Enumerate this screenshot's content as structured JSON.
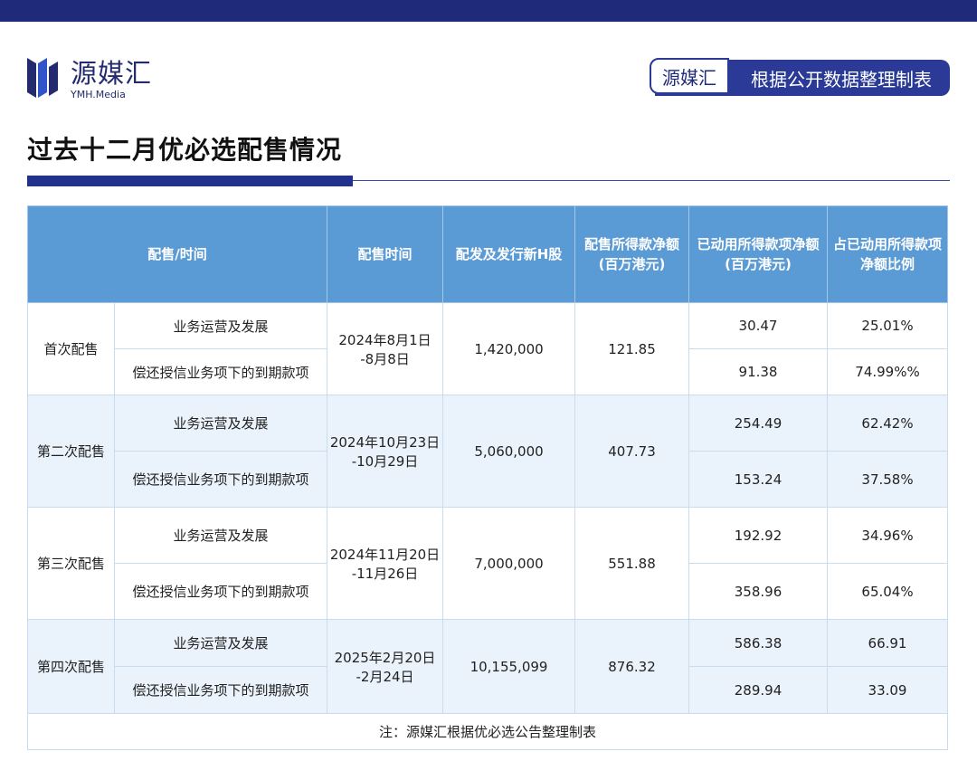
{
  "brand": {
    "name": "源媒汇",
    "sub": "YMH.Media"
  },
  "source_badge": {
    "left": "源媒汇",
    "right": "根据公开数据整理制表"
  },
  "title": "过去十二月优必选配售情况",
  "table": {
    "headers": {
      "col1": "配售/时间",
      "col2": "配售时间",
      "col3": "配发及发行新H股",
      "col4_l1": "配售所得款净额",
      "col4_l2": "(百万港元)",
      "col5_l1": "已动用所得款项净额",
      "col5_l2": "(百万港元)",
      "col6_l1": "占已动用所得款项",
      "col6_l2": "净额比例"
    },
    "groups": [
      {
        "name": "首次配售",
        "date_l1": "2024年8月1日",
        "date_l2": "-8月8日",
        "shares": "1,420,000",
        "net": "121.85",
        "rows": [
          {
            "use": "业务运营及发展",
            "used": "30.47",
            "pct": "25.01%"
          },
          {
            "use": "偿还授信业务项下的到期款项",
            "used": "91.38",
            "pct": "74.99%%"
          }
        ]
      },
      {
        "name": "第二次配售",
        "date_l1": "2024年10月23日",
        "date_l2": "-10月29日",
        "shares": "5,060,000",
        "net": "407.73",
        "rows": [
          {
            "use": "业务运营及发展",
            "used": "254.49",
            "pct": "62.42%"
          },
          {
            "use": "偿还授信业务项下的到期款项",
            "used": "153.24",
            "pct": "37.58%"
          }
        ]
      },
      {
        "name": "第三次配售",
        "date_l1": "2024年11月20日",
        "date_l2": "-11月26日",
        "shares": "7,000,000",
        "net": "551.88",
        "rows": [
          {
            "use": "业务运营及发展",
            "used": "192.92",
            "pct": "34.96%"
          },
          {
            "use": "偿还授信业务项下的到期款项",
            "used": "358.96",
            "pct": "65.04%"
          }
        ]
      },
      {
        "name": "第四次配售",
        "date_l1": "2025年2月20日",
        "date_l2": "-2月24日",
        "shares": "10,155,099",
        "net": "876.32",
        "rows": [
          {
            "use": "业务运营及发展",
            "used": "586.38",
            "pct": "66.91"
          },
          {
            "use": "偿还授信业务项下的到期款项",
            "used": "289.94",
            "pct": "33.09"
          }
        ]
      }
    ],
    "note": "注：源媒汇根据优必选公告整理制表"
  },
  "colors": {
    "topbar": "#1f2a7a",
    "header": "#5b9bd5",
    "alt_row": "#eaf2fb",
    "brand": "#232b6e"
  }
}
